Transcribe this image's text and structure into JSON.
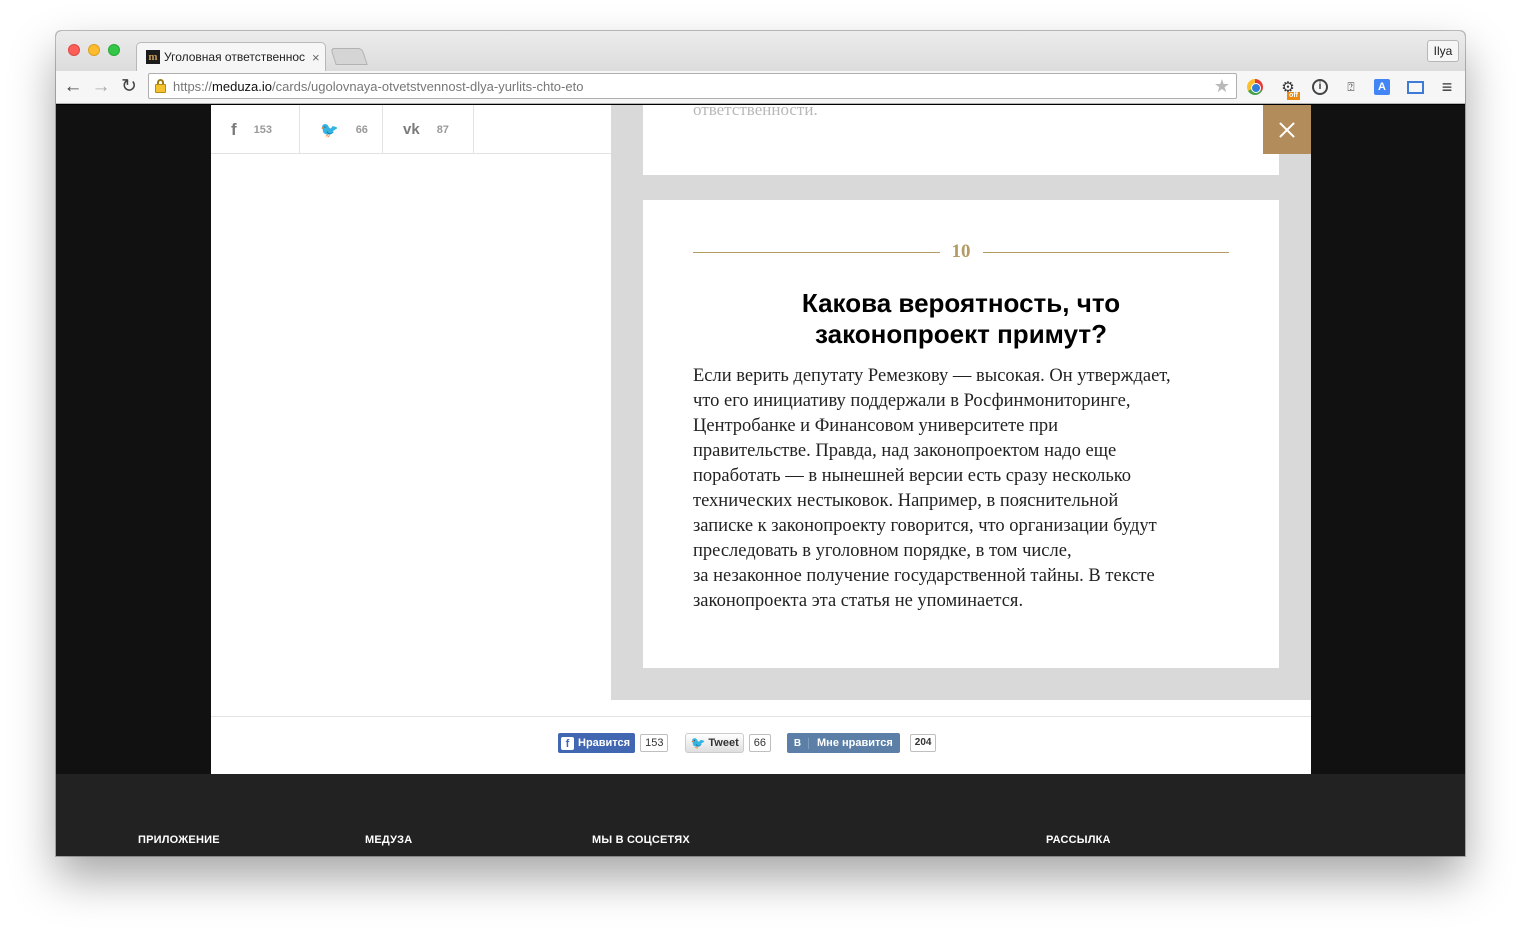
{
  "browser": {
    "tab_title": "Уголовная ответственнос",
    "tab_favicon_letter": "m",
    "profile_name": "Ilya",
    "url": {
      "scheme": "https://",
      "host": "meduza.io",
      "path": "/cards/ugolovnaya-otvetstvennost-dlya-yurlits-chto-eto"
    },
    "nav": {
      "back_glyph": "←",
      "forward_glyph": "→",
      "reload_glyph": "↻",
      "star_glyph": "★",
      "menu_glyph": "≡"
    },
    "extensions": [
      "chrome-extension-icon",
      "off-badge-extension-icon",
      "info-extension-icon",
      "question-extension-icon",
      "translate-extension-icon",
      "screen-capture-icon"
    ],
    "off_badge": "off"
  },
  "share_top": {
    "facebook": {
      "icon": "f",
      "count": "153"
    },
    "twitter": {
      "icon": "🐦",
      "count": "66"
    },
    "vk": {
      "icon": "vk",
      "count": "87"
    }
  },
  "prev_card": {
    "trailing_text": "ответственности."
  },
  "card": {
    "number": "10",
    "title_line1": "Какова вероятность, что",
    "title_line2": "законопроект примут?",
    "body_lines": [
      "Если верить депутату Ремезкову — высокая. Он утверждает,",
      "что его инициативу поддержали в Росфинмониторинге,",
      "Центробанке и Финансовом университете при",
      "правительстве. Правда, над законопроектом надо еще",
      "поработать — в нынешней версии есть сразу несколько",
      "технических нестыковок. Например, в пояснительной",
      "записке к законопроекту говорится, что организации будут",
      "преследовать в уголовном порядке, в том числе,",
      "за незаконное получение государственной тайны. В тексте",
      "законопроекта эта статья не упоминается."
    ]
  },
  "share_bottom": {
    "fb_like_label": "Нравится",
    "fb_count": "153",
    "tweet_label": "Tweet",
    "tweet_count": "66",
    "vk_letter": "В",
    "vk_label": "Мне нравится",
    "vk_count": "204"
  },
  "footer": {
    "app": "ПРИЛОЖЕНИЕ",
    "meduza": "МЕДУЗА",
    "social": "МЫ В СОЦСЕТЯХ",
    "newsletter": "РАССЫЛКА"
  },
  "colors": {
    "accent": "#b28c5b",
    "number_gold": "#b39b63",
    "fb_blue": "#4267b2",
    "vk_blue": "#5b7fa6",
    "footer_bg": "#222222"
  }
}
